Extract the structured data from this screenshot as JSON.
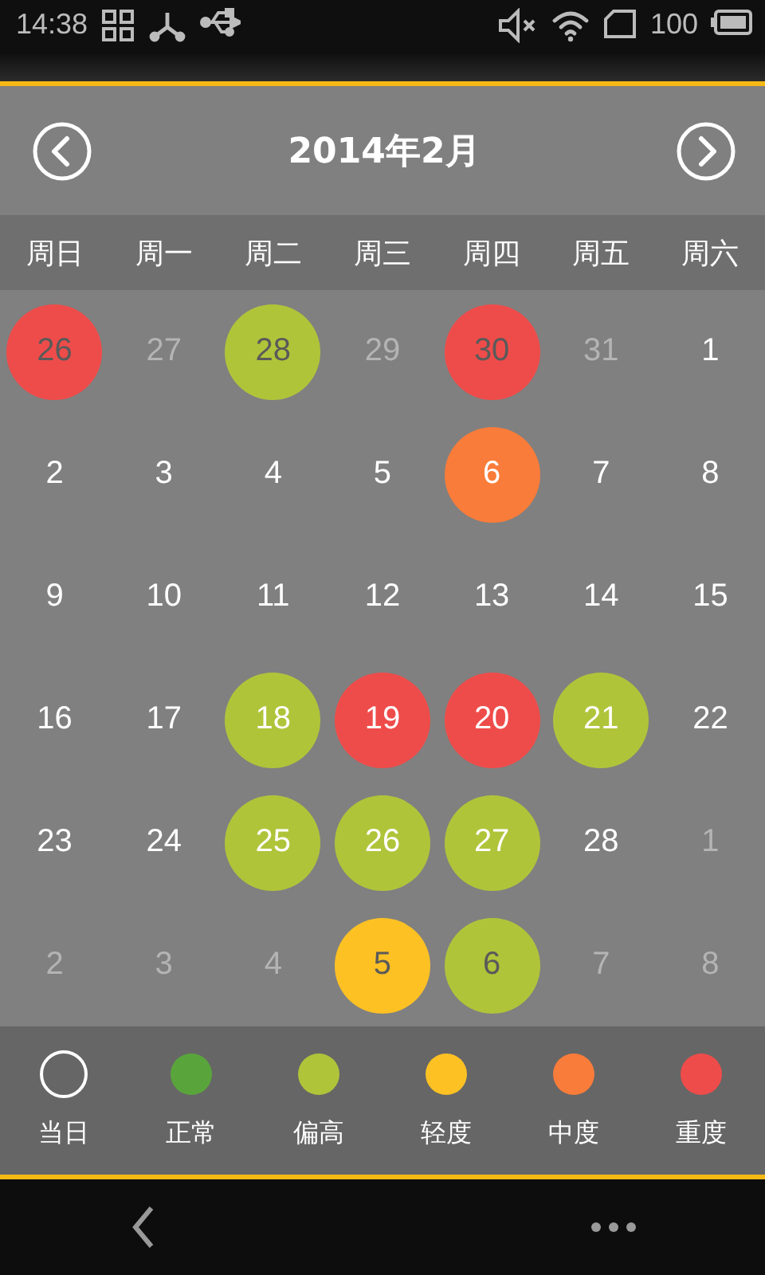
{
  "status_bar": {
    "time": "14:38",
    "battery": "100"
  },
  "header": {
    "title": "2014年2月"
  },
  "weekdays": [
    "周日",
    "周一",
    "周二",
    "周三",
    "周四",
    "周五",
    "周六"
  ],
  "weeks": [
    [
      {
        "label": "26",
        "in_month": false,
        "color": "#ee4c4a"
      },
      {
        "label": "27",
        "in_month": false
      },
      {
        "label": "28",
        "in_month": false,
        "color": "#b0c43a"
      },
      {
        "label": "29",
        "in_month": false
      },
      {
        "label": "30",
        "in_month": false,
        "color": "#ee4c4a"
      },
      {
        "label": "31",
        "in_month": false
      },
      {
        "label": "1",
        "in_month": true
      }
    ],
    [
      {
        "label": "2",
        "in_month": true
      },
      {
        "label": "3",
        "in_month": true
      },
      {
        "label": "4",
        "in_month": true
      },
      {
        "label": "5",
        "in_month": true
      },
      {
        "label": "6",
        "in_month": true,
        "color": "#f97c3a"
      },
      {
        "label": "7",
        "in_month": true
      },
      {
        "label": "8",
        "in_month": true
      }
    ],
    [
      {
        "label": "9",
        "in_month": true
      },
      {
        "label": "10",
        "in_month": true
      },
      {
        "label": "11",
        "in_month": true
      },
      {
        "label": "12",
        "in_month": true
      },
      {
        "label": "13",
        "in_month": true
      },
      {
        "label": "14",
        "in_month": true
      },
      {
        "label": "15",
        "in_month": true
      }
    ],
    [
      {
        "label": "16",
        "in_month": true
      },
      {
        "label": "17",
        "in_month": true
      },
      {
        "label": "18",
        "in_month": true,
        "color": "#b0c43a"
      },
      {
        "label": "19",
        "in_month": true,
        "color": "#ee4c4a"
      },
      {
        "label": "20",
        "in_month": true,
        "color": "#ee4c4a"
      },
      {
        "label": "21",
        "in_month": true,
        "color": "#b0c43a"
      },
      {
        "label": "22",
        "in_month": true
      }
    ],
    [
      {
        "label": "23",
        "in_month": true
      },
      {
        "label": "24",
        "in_month": true
      },
      {
        "label": "25",
        "in_month": true,
        "color": "#b0c43a"
      },
      {
        "label": "26",
        "in_month": true,
        "color": "#b0c43a"
      },
      {
        "label": "27",
        "in_month": true,
        "color": "#b0c43a"
      },
      {
        "label": "28",
        "in_month": true
      },
      {
        "label": "1",
        "in_month": false
      }
    ],
    [
      {
        "label": "2",
        "in_month": false
      },
      {
        "label": "3",
        "in_month": false
      },
      {
        "label": "4",
        "in_month": false
      },
      {
        "label": "5",
        "in_month": false,
        "color": "#fec124"
      },
      {
        "label": "6",
        "in_month": false,
        "color": "#b0c43a"
      },
      {
        "label": "7",
        "in_month": false
      },
      {
        "label": "8",
        "in_month": false
      }
    ]
  ],
  "legend": [
    {
      "label": "当日",
      "kind": "outline"
    },
    {
      "label": "正常",
      "kind": "dot",
      "color": "#59a53c"
    },
    {
      "label": "偏高",
      "kind": "dot",
      "color": "#b0c43a"
    },
    {
      "label": "轻度",
      "kind": "dot",
      "color": "#fec124"
    },
    {
      "label": "中度",
      "kind": "dot",
      "color": "#f97c3a"
    },
    {
      "label": "重度",
      "kind": "dot",
      "color": "#ee4c4a"
    }
  ]
}
